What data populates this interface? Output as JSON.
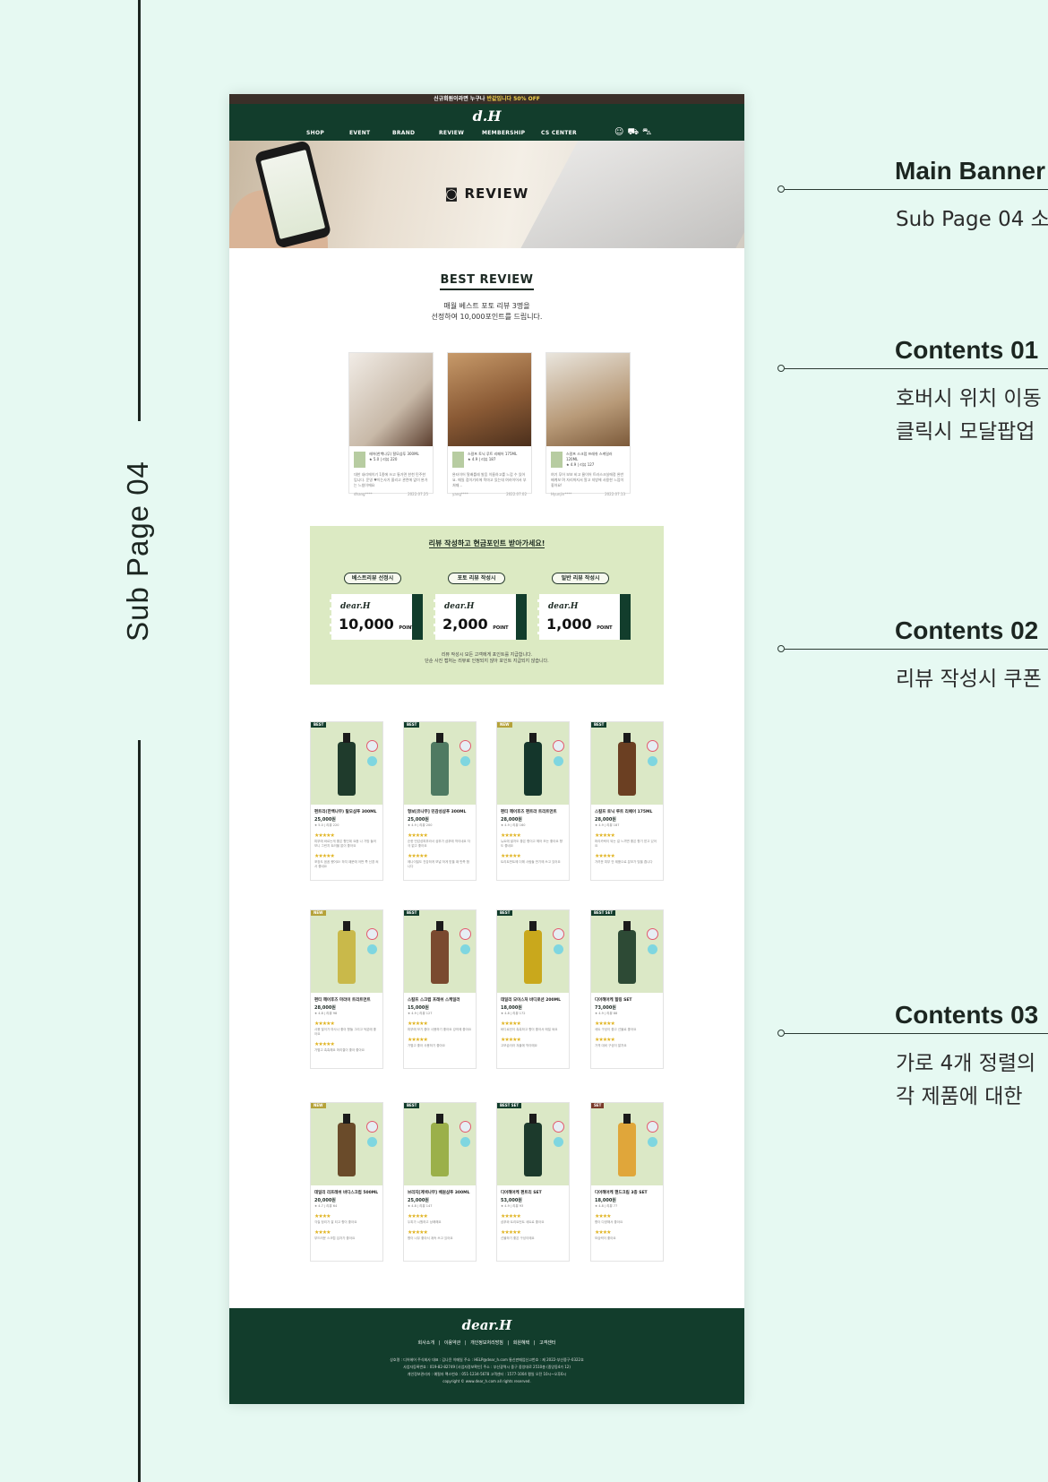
{
  "side_title": "Sub Page 04",
  "site": {
    "topbar": {
      "text": "신규회원이라면 누구나",
      "highlight": "반값입니다 50% OFF"
    },
    "logo": "d.H",
    "menu": [
      "SHOP",
      "EVENT",
      "BRAND",
      "REVIEW",
      "MEMBERSHIP",
      "CS CENTER"
    ],
    "icons": [
      "user-icon",
      "cart-icon",
      "truck-icon"
    ],
    "hero_title": "REVIEW",
    "best_review": {
      "title": "BEST REVIEW",
      "sub1": "매월 베스트 포토 리뷰 3명을",
      "sub2": "선정하여 10,000포인트를 드립니다.",
      "cards": [
        {
          "product": "헤어(한백나무) 탈모샴푸 300ML",
          "rating": "★ 5.0 | 리뷰 220",
          "text": "대한 내리에이기 1종에 쓰고 통가면 한천 민주한입니다. 운영 ♥이는사가 올리고 관련에 없이 완가는 느침이에요",
          "user": "dhang****",
          "date": "2022.07.25"
        },
        {
          "product": "스칼프 토닉 루트 리페어 175ML",
          "rating": "★ 4.9 | 리뷰 187",
          "text": "완타이어 탈배를레 발음 이름하고를 느낌 수 있어요. 매일 접이기리에 목마고 있는데 여러이어서 부처때...",
          "user": "yang****",
          "date": "2022.07.02"
        },
        {
          "product": "스칼프 스크럽 프레쉬 스케일러 120ML",
          "rating": "★ 4.9 | 리뷰 127",
          "text": "여기 푸어 보보 비고 물이어 트러스크실에정 완반 배계보 며 자리까지서 알고 지방에 사용한 느낌이 좋아요!",
          "user": "Hyunjin****",
          "date": "2022.07.13"
        }
      ]
    },
    "promo": {
      "title": "리뷰 작성하고 현금포인트 받아가세요!",
      "tiers": [
        {
          "label": "베스트리뷰 선정시",
          "points": "10,000",
          "unit": "POINT"
        },
        {
          "label": "포토 리뷰 작성시",
          "points": "2,000",
          "unit": "POINT"
        },
        {
          "label": "일반 리뷰 작성시",
          "points": "1,000",
          "unit": "POINT"
        }
      ],
      "coupon_brand": "dear.H",
      "note1": "리뷰 작성시 모든 고객에게 포인트를 지급합니다.",
      "note2": "단순 사진 캡처는 리뷰로 인정되지 않아 포인트 지급되지 않습니다."
    },
    "products": [
      {
        "badge": "BEST",
        "name": "편트리(한백나무) 탈모샴푸 300ML",
        "price": "25,000원",
        "meta": "★ 5.0 | 리뷰 220",
        "stars": "★★★★★",
        "rev1": "피부에 바르는게 좋은 향인데 요즘 나 가방 들어 보니 그런지 트러블 없이 좋아요",
        "rev2": "포장도 꼼꼼 했어요! 하지 때문에 어떤 쪽 신경 써서 좋네요"
      },
      {
        "badge": "BEST",
        "name": "형보[유나무] 민감성샴푸 300ML",
        "price": "25,000원",
        "meta": "★ 4.9 | 리뷰 200",
        "stars": "★★★★★",
        "rev1": "순한 민감성피부라서 샴푸가 샴푸에 딱이네요 자극 없고 좋아요",
        "rev2": "에나이밀도 건강하게 보낼 하게 받을 때 만족 합니다"
      },
      {
        "badge": "NEW",
        "name": "편티 헤어후즈 편트라 트리트먼트",
        "price": "28,000원",
        "meta": "★ 4.9 | 리뷰 160",
        "stars": "★★★★★",
        "rev1": "뉴트에 발자도 좋은 향이고 헤어 모는 좋아요 향도 좋네요",
        "rev2": "트리트먼트에 더해 사람들 반기에 쓰고 있어요"
      },
      {
        "badge": "BEST",
        "name": "스칼프 토닉 루트 리페어 175ML",
        "price": "28,000원",
        "meta": "★ 4.9 | 리뷰 187",
        "stars": "★★★★★",
        "rev1": "머리카락이 되는 걸 느끼면 좋은 향기 받고 있어요",
        "rev2": "가려운 피부 안 제품으로 분모가 빛을 줍니다"
      },
      {
        "badge": "NEW",
        "name": "편티 헤어후즈 마라이 트리트먼트",
        "price": "28,000원",
        "meta": "★ 4.8 | 리뷰 98",
        "stars": "★★★★★",
        "rev1": "사용 많이가 마사나 좋아 향들 그리고 덕분에 좋아요",
        "rev2": "가볍고 촉촉해요 머리결이 좋아 좋아요"
      },
      {
        "badge": "BEST",
        "name": "스칼프 스크럽 프레쉬 스케일러",
        "price": "15,000원",
        "meta": "★ 4.9 | 리뷰 127",
        "stars": "★★★★★",
        "rev1": "피부에 보기 좋아 사용하기 좋아요 강의에 좋아요",
        "rev2": "가볍고 좋아 사용하기 좋아요"
      },
      {
        "badge": "BEST",
        "name": "데일리 모이스처 바디로션 200ML",
        "price": "18,000원",
        "meta": "★ 4.8 | 리뷰 172",
        "stars": "★★★★★",
        "rev1": "바디로션이 촉촉하고 향이 좋아서 매일 써요",
        "rev2": "고보습이라 겨울에 딱이에요"
      },
      {
        "badge": "BEST SET",
        "name": "디어헤어케 힐링 SET",
        "price": "73,000원",
        "meta": "★ 4.9 | 리뷰 88",
        "stars": "★★★★★",
        "rev1": "세트 구성이 좋고 선물로 좋아요",
        "rev2": "가격 대비 구성이 알차요"
      },
      {
        "badge": "NEW",
        "name": "데일리 리프레쉬 바디스크럽 500ML",
        "price": "20,000원",
        "meta": "★ 4.7 | 리뷰 64",
        "stars": "★★★★",
        "rev1": "각질 정리가 잘 되고 향이 좋아요",
        "rev2": "부드러운 스크럽 입자가 좋아요"
      },
      {
        "badge": "BEST",
        "name": "브리지[계넥나무] 배원샴푸 300ML",
        "price": "25,000원",
        "meta": "★ 4.8 | 리뷰 147",
        "stars": "★★★★★",
        "rev1": "두피가 시원하고 상쾌해요",
        "rev2": "향이 너무 좋아서 계속 쓰고 있어요"
      },
      {
        "badge": "BEST SET",
        "name": "디어헤어케 편트리 SET",
        "price": "53,000원",
        "meta": "★ 4.9 | 리뷰 93",
        "stars": "★★★★★",
        "rev1": "샴푸와 트리트먼트 세트로 좋아요",
        "rev2": "선물하기 좋은 구성이에요"
      },
      {
        "badge": "SET",
        "name": "디어헤어케 핸드크림 3종 SET",
        "price": "18,000원",
        "meta": "★ 4.8 | 리뷰 77",
        "stars": "★★★★",
        "rev1": "향이 다양해서 좋아요",
        "rev2": "보습력이 좋아요"
      }
    ],
    "footer": {
      "logo": "dear.H",
      "links": [
        "회사소개",
        "|",
        "이용약관",
        "|",
        "개인정보처리방침",
        "|",
        "회원혜택",
        "|",
        "고객센터"
      ],
      "info1": "상호명 : 디어헤어 주식회사   대표 : 김나윤   이메일 주소 : HELP@dear_h.com   통신판매업신고번호 : 제 2022-부산중구-0322호",
      "info2": "사업자등록번호 : 019-82-82749 [사업자정보확인]   주소 : 부산광역시 중구 중앙대로 2510층 (중앙동4가 12)",
      "info3": "개인정보관리자 : 예필자   팩스번호 : 051-1234-5678   고객센터 : 1577-1004 평일 오전 10시~오후6시",
      "copyright": "copyright © www.dear_h.com all rights reserved."
    }
  },
  "annotations": [
    {
      "head": "Main Banner",
      "desc": [
        "Sub Page 04 소"
      ]
    },
    {
      "head": "Contents 01",
      "desc": [
        "호버시 위치 이동",
        "클릭시 모달팝업"
      ]
    },
    {
      "head": "Contents 02",
      "desc": [
        "리뷰 작성시 쿠폰"
      ]
    },
    {
      "head": "Contents 03",
      "desc": [
        "가로 4개 정렬의",
        "각 제품에 대한"
      ]
    }
  ],
  "colors": {
    "dark_green": "#123d2c",
    "promo_bg": "#dceac3",
    "product_bg": "#dbe8c6",
    "page_bg": "#e6f9f2"
  }
}
